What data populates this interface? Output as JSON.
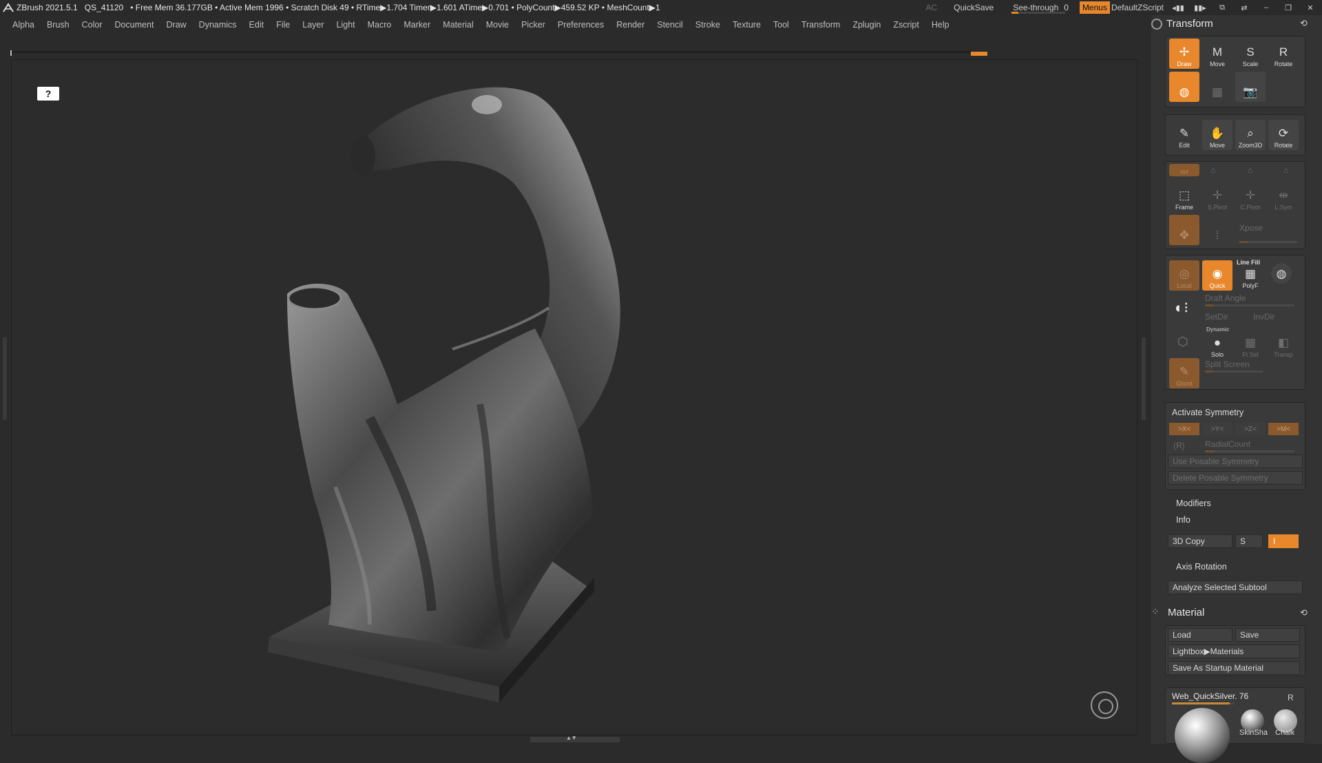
{
  "titlebar": {
    "app": "ZBrush 2021.5.1",
    "qs": "QS_41120",
    "stats": "• Free Mem 36.177GB • Active Mem 1996 • Scratch Disk 49 • RTime▶1.704 Timer▶1.601 ATime▶0.701 • PolyCount▶459.52 KP • MeshCount▶1",
    "ac": "AC",
    "quicksave": "QuickSave",
    "seethrough_label": "See-through",
    "seethrough_value": "0",
    "seethrough_fraction": 0,
    "menus": "Menus",
    "script": "DefaultZScript"
  },
  "menubar": [
    "Alpha",
    "Brush",
    "Color",
    "Document",
    "Draw",
    "Dynamics",
    "Edit",
    "File",
    "Layer",
    "Light",
    "Macro",
    "Marker",
    "Material",
    "Movie",
    "Picker",
    "Preferences",
    "Render",
    "Stencil",
    "Stroke",
    "Texture",
    "Tool",
    "Transform",
    "Zplugin",
    "Zscript",
    "Help"
  ],
  "transform": {
    "title": "Transform",
    "tools_row1": [
      {
        "label": "Draw",
        "glyph": "✢",
        "icon": "draw-icon"
      },
      {
        "label": "Move",
        "glyph": "M",
        "icon": "move-icon"
      },
      {
        "label": "Scale",
        "glyph": "S",
        "icon": "scale-icon"
      },
      {
        "label": "Rotate",
        "glyph": "R",
        "icon": "rotate-icon"
      }
    ],
    "tools_row3": [
      {
        "label": "Edit",
        "glyph": "✎",
        "icon": "edit-icon"
      },
      {
        "label": "Move",
        "glyph": "✋",
        "icon": "pan-icon"
      },
      {
        "label": "Zoom3D",
        "glyph": "⌕",
        "icon": "zoom3d-icon"
      },
      {
        "label": "Rotate",
        "glyph": "⟳",
        "icon": "rotate-view-icon"
      }
    ],
    "frame_row": [
      {
        "label": "Frame",
        "glyph": "⬚",
        "icon": "frame-icon"
      },
      {
        "label": "S.Pivot",
        "glyph": "✛",
        "icon": "spivot-icon"
      },
      {
        "label": "C.Pivot",
        "glyph": "✛",
        "icon": "cpivot-icon"
      },
      {
        "label": "L.Sym",
        "glyph": "⇹",
        "icon": "lsym-icon"
      }
    ],
    "xpose": "Xpose",
    "line_fill": "Line Fill",
    "row_quick": [
      {
        "label": "Local",
        "glyph": "◎",
        "icon": "local-icon"
      },
      {
        "label": "Quick",
        "glyph": "◉",
        "icon": "quick-icon"
      },
      {
        "label": "PolyF",
        "glyph": "▦",
        "icon": "polyframe-icon"
      }
    ],
    "draft_angle": "Draft Angle",
    "setdir": "SetDir",
    "invdir": "InvDir",
    "dynamic": "Dynamic",
    "solo": "Solo",
    "ftsel": "Ft Sel",
    "transp": "Transp",
    "split_screen": "Split Screen",
    "ghost": "Ghost",
    "activate_symmetry": "Activate Symmetry",
    "sym_buttons": [
      ">X<",
      ">Y<",
      ">Z<",
      ">M<"
    ],
    "r_label": "(R)",
    "radialcount": "RadialCount",
    "use_posable": "Use Posable Symmetry",
    "delete_posable": "Delete Posable Symmetry",
    "modifiers": "Modifiers",
    "info": "Info",
    "copy3d": "3D Copy",
    "copy_s": "S",
    "axis_rotation": "Axis Rotation",
    "analyze": "Analyze Selected Subtool"
  },
  "material": {
    "title": "Material",
    "load": "Load",
    "save": "Save",
    "lightbox": "Lightbox▶Materials",
    "save_startup": "Save As Startup Material",
    "current": "Web_QuickSilver. 76",
    "r": "R",
    "swatches": [
      "SkinSha",
      "Chalk"
    ]
  },
  "viewport": {
    "help_glyph": "?"
  }
}
